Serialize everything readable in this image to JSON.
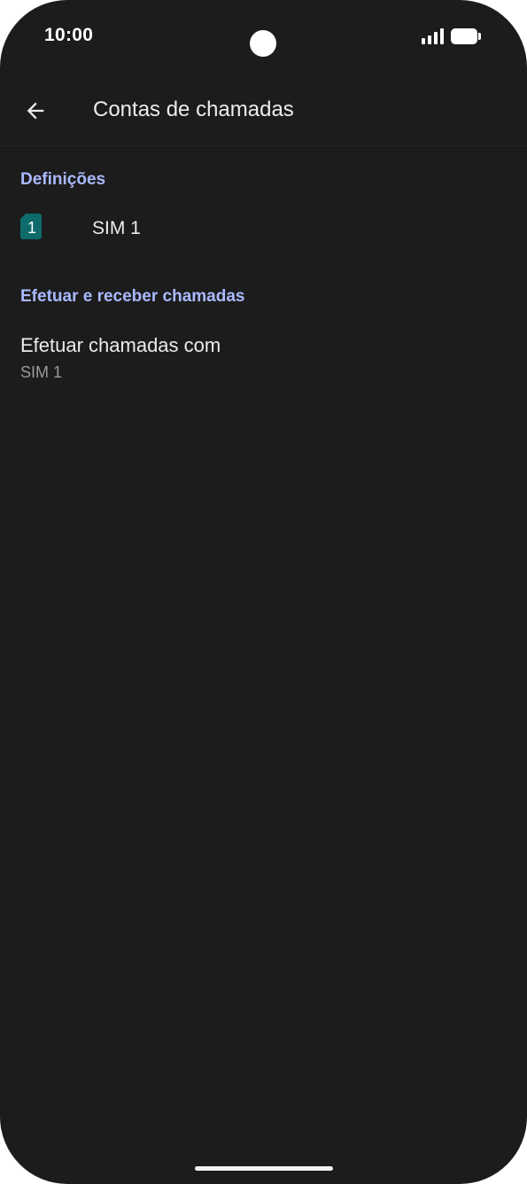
{
  "status_bar": {
    "time": "10:00",
    "signal_icon": "signal-bars-icon",
    "battery_icon": "battery-full-icon"
  },
  "app_bar": {
    "back_icon": "arrow-back-icon",
    "title": "Contas de chamadas"
  },
  "sections": {
    "settings": {
      "header": "Definições",
      "sim_item": {
        "icon": "sim-card-icon",
        "icon_number": "1",
        "label": "SIM 1"
      }
    },
    "calls": {
      "header": "Efetuar e receber chamadas",
      "item": {
        "title": "Efetuar chamadas com",
        "value": "SIM 1"
      }
    }
  },
  "colors": {
    "background": "#1c1c1c",
    "accent_header": "#a9b9ff",
    "sim_icon": "#0e6b6b",
    "primary_text": "#ececec",
    "secondary_text": "#9a9a9a"
  }
}
